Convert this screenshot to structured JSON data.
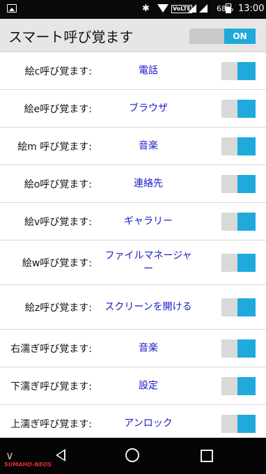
{
  "status_bar": {
    "battery_percent": "68%",
    "time": "13:00",
    "network_badge": "VoLTE"
  },
  "header": {
    "title": "スマート呼び覚ます",
    "master_toggle": "ON"
  },
  "rows": [
    {
      "label": "絵c呼び覚ます:",
      "value": "電話",
      "h": 54
    },
    {
      "label": "絵e呼び覚ます:",
      "value": "ブラウザ",
      "h": 54
    },
    {
      "label": "絵m 呼び覚ます:",
      "value": "音楽",
      "h": 54
    },
    {
      "label": "絵o呼び覚ます:",
      "value": "連絡先",
      "h": 54
    },
    {
      "label": "絵v呼び覚ます:",
      "value": "ギャラリー",
      "h": 54
    },
    {
      "label": "絵w呼び覚ます:",
      "value": "ファイルマネージャー",
      "h": 64
    },
    {
      "label": "絵z呼び覚ます:",
      "value": "スクリーンを開ける",
      "h": 64
    },
    {
      "label": "右濡ぎ呼び覚ます:",
      "value": "音楽",
      "h": 54
    },
    {
      "label": "下濡ぎ呼び覚ます:",
      "value": "設定",
      "h": 54
    },
    {
      "label": "上濡ぎ呼び覚ます:",
      "value": "アンロック",
      "h": 54
    }
  ],
  "colors": {
    "accent": "#1fa9dd",
    "value_text": "#1a1ac8"
  },
  "nav": {
    "watermark": "SUMAHO-NEOS"
  }
}
